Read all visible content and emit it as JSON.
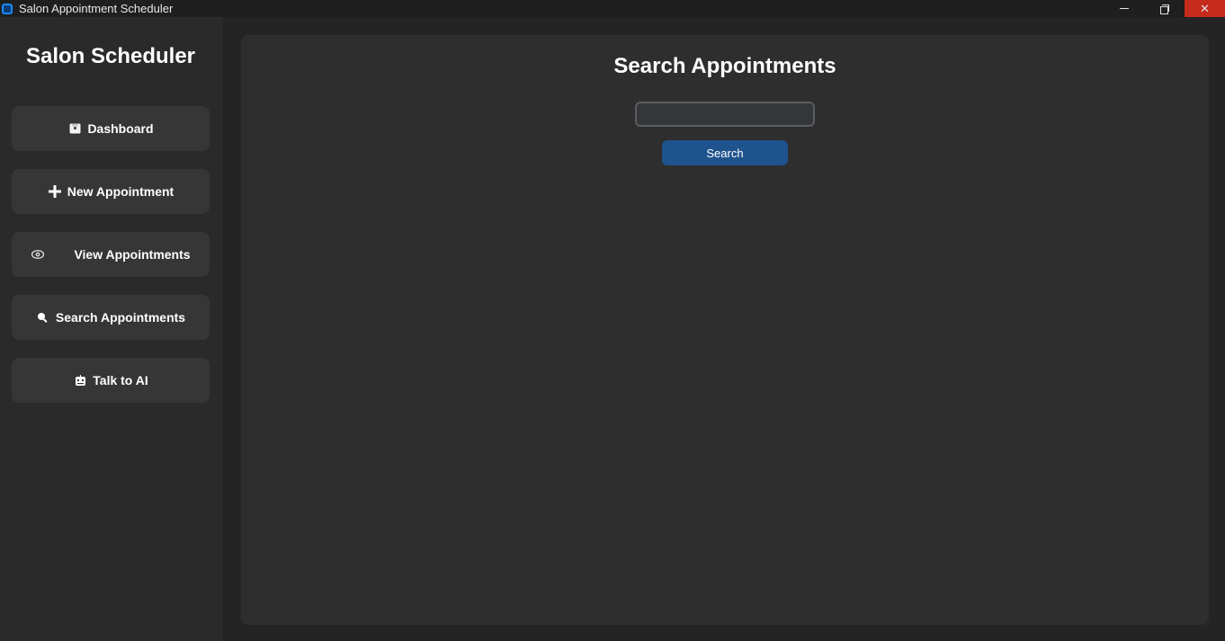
{
  "window": {
    "title": "Salon Appointment Scheduler",
    "controls": {
      "close_glyph": "✕"
    }
  },
  "sidebar": {
    "brand": "Salon Scheduler",
    "items": [
      {
        "label": "Dashboard",
        "icon": "dashboard-icon"
      },
      {
        "label": "New Appointment",
        "icon": "plus-icon"
      },
      {
        "label": "View Appointments",
        "icon": "eye-icon"
      },
      {
        "label": "Search Appointments",
        "icon": "search-icon"
      },
      {
        "label": "Talk to AI",
        "icon": "robot-icon"
      }
    ]
  },
  "main": {
    "title": "Search Appointments",
    "search": {
      "value": "",
      "button_label": "Search"
    }
  },
  "colors": {
    "sidebar_bg": "#2a2a2a",
    "nav_button_bg": "#363636",
    "main_bg": "#2e2e2e",
    "accent": "#1f538d",
    "close_red": "#c42b1c"
  }
}
